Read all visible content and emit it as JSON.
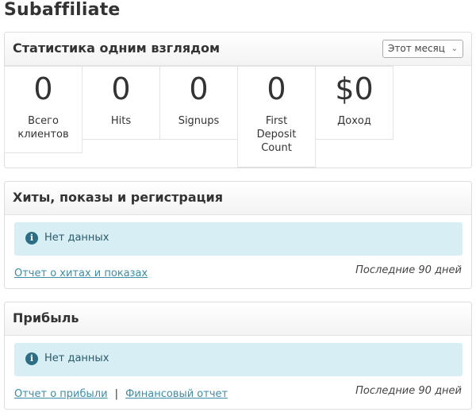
{
  "page": {
    "title": "Subaffiliate"
  },
  "stats_panel": {
    "title": "Статистика одним взглядом",
    "period": "Этот месяц",
    "stats": [
      {
        "value": "0",
        "label": "Всего клиентов"
      },
      {
        "value": "0",
        "label": "Hits"
      },
      {
        "value": "0",
        "label": "Signups"
      },
      {
        "value": "0",
        "label": "First Deposit Count"
      },
      {
        "value": "$0",
        "label": "Доход"
      }
    ]
  },
  "hits_panel": {
    "title": "Хиты, показы и регистрация",
    "empty_message": "Нет данных",
    "report_link": "Отчет о хитах и показах",
    "period_note": "Последние 90 дней"
  },
  "profit_panel": {
    "title": "Прибыль",
    "empty_message": "Нет данных",
    "profit_link": "Отчет о прибыли",
    "separator": "|",
    "financial_link": "Финансовый отчет",
    "period_note": "Последние 90 дней"
  },
  "icons": {
    "info": "info-circle-icon",
    "dropdown": "chevron-down-icon"
  }
}
